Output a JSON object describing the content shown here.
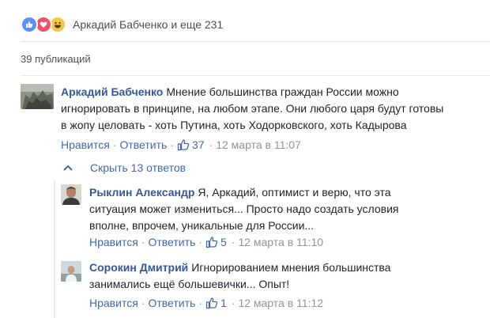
{
  "reactions": {
    "icons": [
      "like-icon",
      "love-icon",
      "haha-icon"
    ],
    "text": "Аркадий Бабченко и еще 231"
  },
  "publications": "39 публикаций",
  "main_comment": {
    "author": "Аркадий Бабченко",
    "line1": "Мнение большинства граждан России можно",
    "line2": "игнорировать в принципе, на любом этапе. Они любого царя будут готовы",
    "line3": "в жопу целовать - хоть Путина, хоть Ходорковского, хоть Кадырова",
    "like": "Нравится",
    "reply": "Ответить",
    "likes": "37",
    "time": "12 марта в 11:07"
  },
  "hide_replies": "Скрыть 13 ответов",
  "replies": [
    {
      "author": "Рыклин Александр",
      "line1": "Я, Аркадий, оптимист и верю, что эта",
      "line2": "ситуация может измениться... Просто надо создать условия",
      "line3": "вполне, впрочем, уникальные для России...",
      "like": "Нравится",
      "reply": "Ответить",
      "likes": "5",
      "time": "12 марта в 11:10"
    },
    {
      "author": "Сорокин Дмитрий",
      "line1": "Игнорированием мнения большинства",
      "line2": "занимались ещё большевички... Опыт!",
      "like": "Нравится",
      "reply": "Ответить",
      "likes": "1",
      "time": "12 марта в 11:12"
    }
  ],
  "colors": {
    "link": "#365899",
    "action": "#4267b2",
    "meta": "#90949c",
    "like_reaction": "#5890ff",
    "love_reaction": "#f25268",
    "haha_reaction": "#f7c54a"
  }
}
